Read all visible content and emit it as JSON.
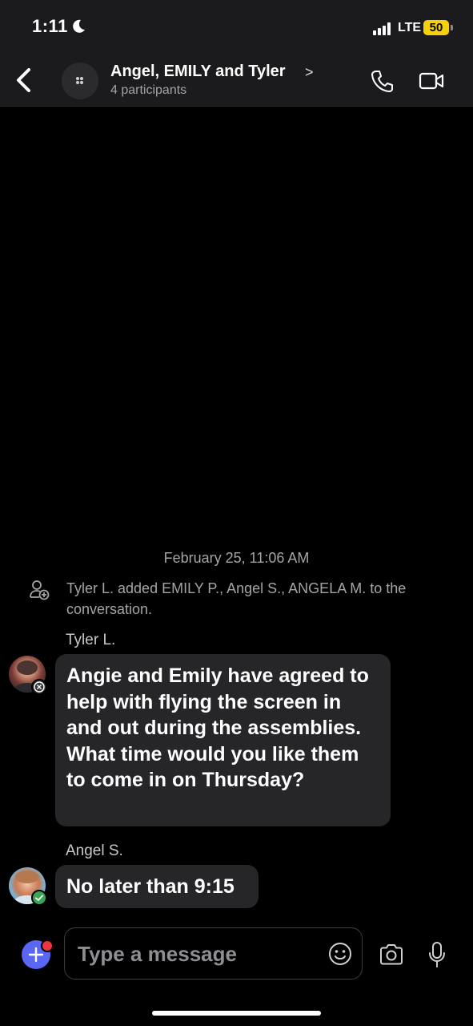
{
  "status_bar": {
    "time": "1:11",
    "network": "LTE",
    "battery": "50"
  },
  "header": {
    "title": "Angel, EMILY and Tyler",
    "chevron": ">",
    "subtitle": "4 participants"
  },
  "conversation": {
    "date_stamp": "February 25, 11:06 AM",
    "system_message": "Tyler L. added EMILY P., Angel S., ANGELA M. to the conversation.",
    "messages": [
      {
        "sender": "Tyler L.",
        "text": "Angie and Emily have agreed to help with flying the screen in and out during the assemblies. What time would you like them to come in on Thursday?"
      },
      {
        "sender": "Angel S.",
        "text": "No later than 9:15"
      }
    ]
  },
  "composer": {
    "placeholder": "Type a message"
  },
  "colors": {
    "background": "#000000",
    "bar": "#1b1b1d",
    "bubble": "#262628",
    "accent": "#5a67f5",
    "notification": "#ef3340",
    "online": "#3aa655",
    "battery": "#f5d10b"
  },
  "icons": [
    "moon-icon",
    "signal-icon",
    "back-icon",
    "group-icon",
    "phone-icon",
    "video-icon",
    "add-person-icon",
    "plus-icon",
    "emoji-icon",
    "camera-icon",
    "mic-icon"
  ]
}
